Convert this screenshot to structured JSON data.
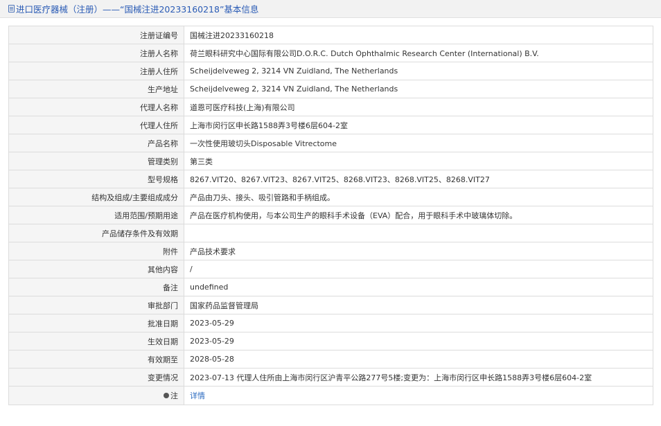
{
  "header": {
    "icon": "document-icon",
    "title": "进口医疗器械（注册）——“国械注进20233160218”基本信息",
    "color": "#2a5bb5"
  },
  "rows": [
    {
      "label": "注册证编号",
      "value": "国械注进20233160218"
    },
    {
      "label": "注册人名称",
      "value": "荷兰眼科研究中心国际有限公司D.O.R.C. Dutch Ophthalmic Research Center (International) B.V."
    },
    {
      "label": "注册人住所",
      "value": "Scheijdelveweg 2, 3214 VN Zuidland, The Netherlands"
    },
    {
      "label": "生产地址",
      "value": "Scheijdelveweg 2, 3214 VN Zuidland, The Netherlands"
    },
    {
      "label": "代理人名称",
      "value": "道恩可医疗科技(上海)有限公司"
    },
    {
      "label": "代理人住所",
      "value": "上海市闵行区申长路1588弄3号楼6层604-2室"
    },
    {
      "label": "产品名称",
      "value": "一次性使用玻切头Disposable Vitrectome"
    },
    {
      "label": "管理类别",
      "value": "第三类"
    },
    {
      "label": "型号规格",
      "value": "8267.VIT20、8267.VIT23、8267.VIT25、8268.VIT23、8268.VIT25、8268.VIT27"
    },
    {
      "label": "结构及组成/主要组成成分",
      "value": "产品由刀头、接头、吸引管路和手柄组成。"
    },
    {
      "label": "适用范围/预期用途",
      "value": "产品在医疗机构使用，与本公司生产的眼科手术设备（EVA）配合，用于眼科手术中玻璃体切除。"
    },
    {
      "label": "产品储存条件及有效期",
      "value": ""
    },
    {
      "label": "附件",
      "value": "产品技术要求"
    },
    {
      "label": "其他内容",
      "value": "/"
    },
    {
      "label": "备注",
      "value": "undefined"
    },
    {
      "label": "审批部门",
      "value": "国家药品监督管理局"
    },
    {
      "label": "批准日期",
      "value": "2023-05-29"
    },
    {
      "label": "生效日期",
      "value": "2023-05-29"
    },
    {
      "label": "有效期至",
      "value": "2028-05-28"
    },
    {
      "label": "变更情况",
      "value": "2023-07-13 代理人住所由上海市闵行区沪青平公路277号5楼;变更为：上海市闵行区申长路1588弄3号楼6层604-2室"
    }
  ],
  "note_row": {
    "icon": "pin-icon",
    "label": "注",
    "link": "详情",
    "link_color": "#2a6ac0"
  }
}
